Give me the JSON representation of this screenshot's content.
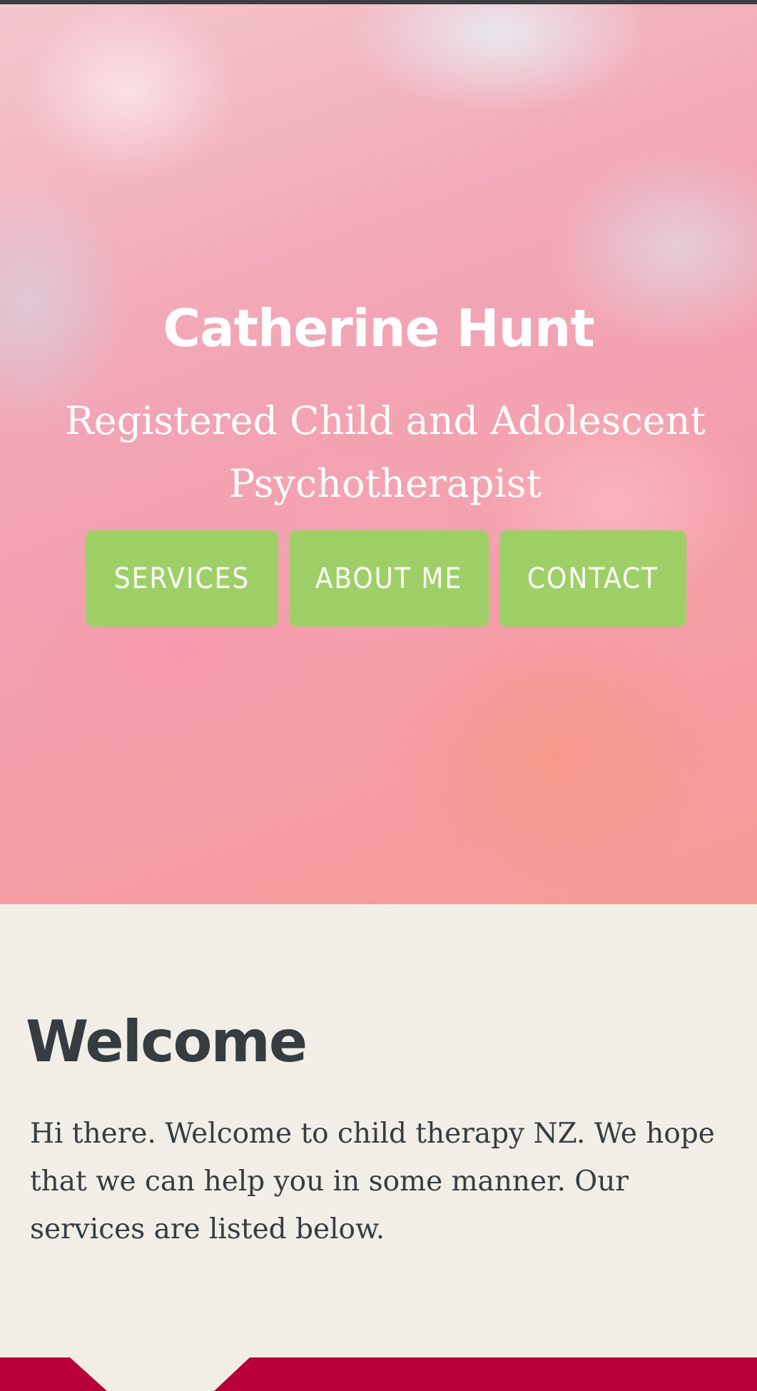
{
  "hero": {
    "title": "Catherine Hunt",
    "subtitle": "Registered Child and Adolescent Psychotherapist",
    "buttons": [
      {
        "label": "SERVICES"
      },
      {
        "label": "ABOUT ME"
      },
      {
        "label": "CONTACT"
      }
    ],
    "button_color": "#9fd067"
  },
  "welcome": {
    "title": "Welcome",
    "text": "Hi there. Welcome to child therapy NZ. We hope that we can help you in some manner. Our services are listed below."
  },
  "colors": {
    "page_background": "#f1eee8",
    "text": "#363c40",
    "footer_accent": "#b8003a"
  }
}
